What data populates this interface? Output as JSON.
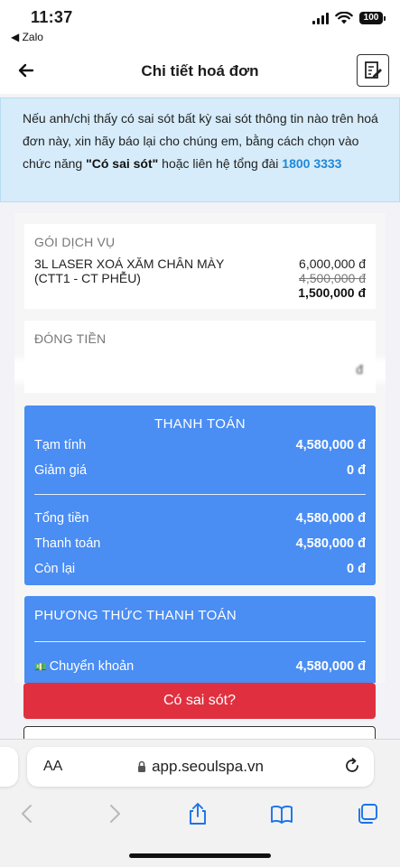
{
  "status_bar": {
    "time": "11:37",
    "back_app": "◀ Zalo",
    "battery": "100"
  },
  "header": {
    "title": "Chi tiết hoá đơn"
  },
  "notice": {
    "text_before": "Nếu anh/chị thấy có sai sót bất kỳ sai sót thông tin nào trên hoá đơn này, xin hãy báo lại cho chúng em, bằng cách chọn vào chức năng ",
    "highlight": "\"Có sai sót\"",
    "text_after": " hoặc liên hệ tổng đài ",
    "phone": "1800 3333"
  },
  "service": {
    "label": "GÓI DỊCH VỤ",
    "name": "3L LASER XOÁ XĂM CHÂN MÀY (CTT1 - CT PHỄU)",
    "price_original": "6,000,000 đ",
    "price_struck": "4,500,000 đ",
    "price_final": "1,500,000 đ"
  },
  "payment": {
    "label": "ĐÓNG TIỀN",
    "blurred_value": "đ"
  },
  "summary": {
    "title": "THANH TOÁN",
    "rows": [
      {
        "label": "Tạm tính",
        "value": "4,580,000 đ"
      },
      {
        "label": "Giảm giá",
        "value": "0 đ"
      },
      {
        "label": "Tổng tiền",
        "value": "4,580,000 đ"
      },
      {
        "label": "Thanh toán",
        "value": "4,580,000 đ"
      },
      {
        "label": "Còn lại",
        "value": "0 đ"
      }
    ]
  },
  "method": {
    "title": "PHƯƠNG THỨC THANH TOÁN",
    "icon": "money-icon",
    "label": "Chuyển khoản",
    "value": "4,580,000 đ"
  },
  "actions": {
    "report_label": "Có sai sót?"
  },
  "browser": {
    "aa_label": "AA",
    "url": "app.seoulspa.vn"
  },
  "colors": {
    "accent_blue": "#4a8df3",
    "report_red": "#e0303f",
    "notice_bg": "#d6ecfa",
    "phone_blue": "#1e88d8"
  }
}
